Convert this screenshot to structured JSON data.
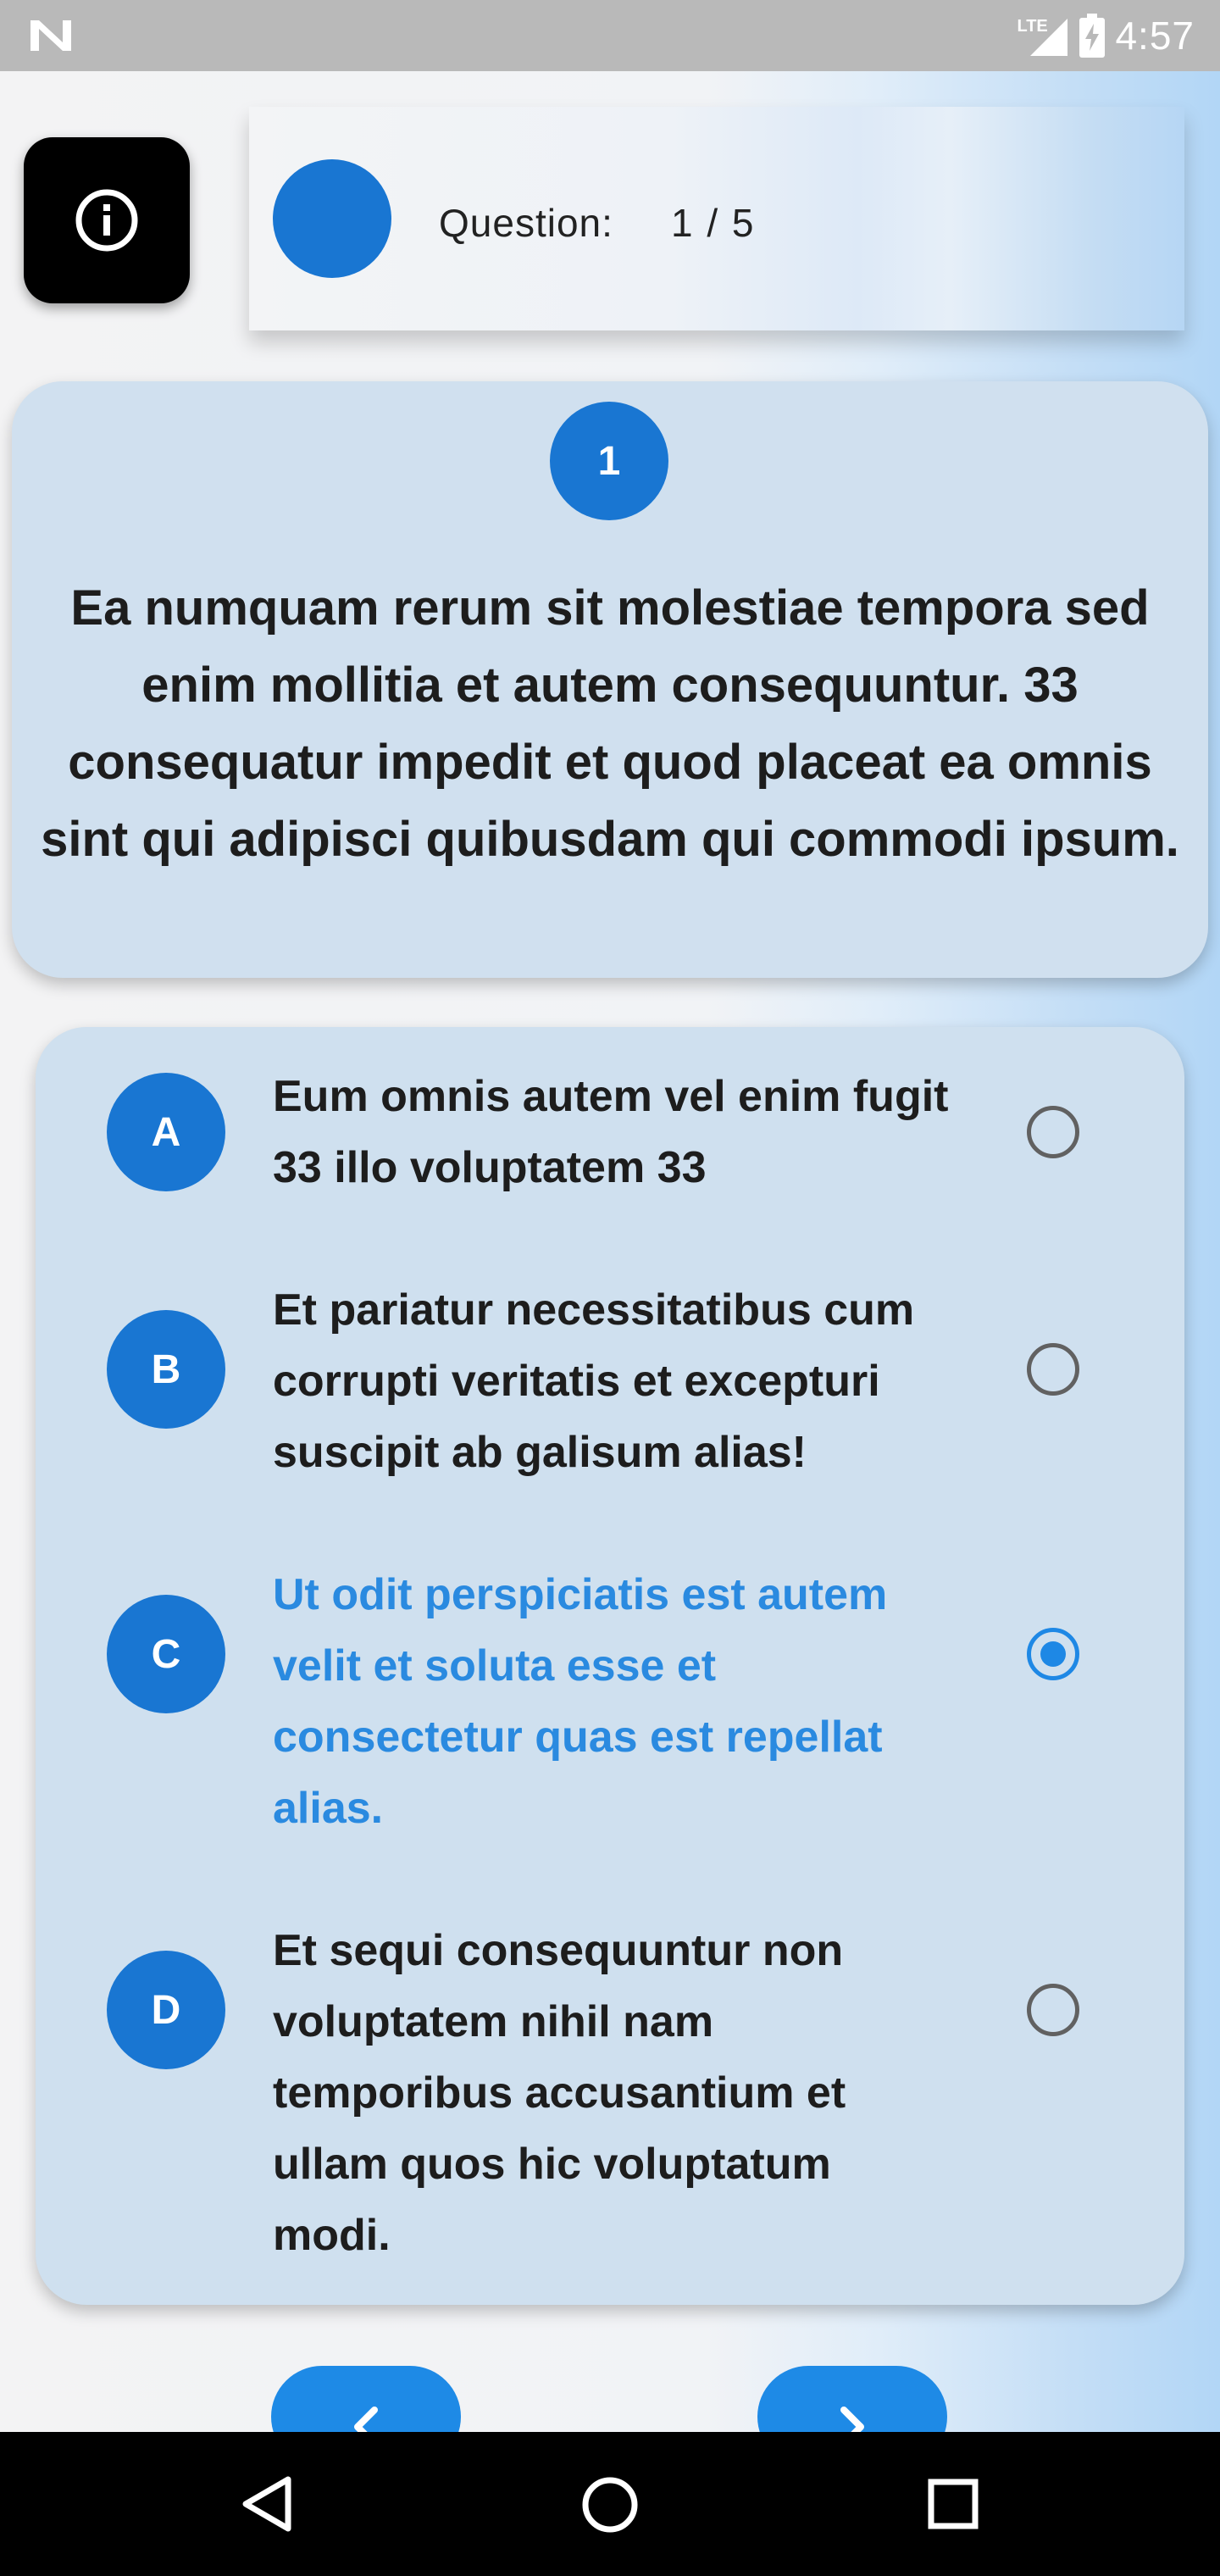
{
  "status_bar": {
    "time": "4:57",
    "network": "LTE",
    "icons": [
      "notification-n-icon",
      "signal-icon",
      "battery-charging-icon"
    ]
  },
  "header": {
    "info_icon": "info-icon",
    "question_label": "Question:",
    "question_counter": "1 / 5"
  },
  "question": {
    "number": "1",
    "text": "Ea numquam rerum sit molestiae tempora sed enim mollitia et autem consequuntur. 33 consequatur impedit et quod placeat ea omnis sint qui adipisci quibusdam qui commodi ipsum."
  },
  "options": [
    {
      "letter": "A",
      "text": "Eum omnis autem vel enim fugit 33 illo voluptatem 33",
      "selected": false
    },
    {
      "letter": "B",
      "text": "Et pariatur necessitatibus cum corrupti veritatis et excepturi suscipit ab galisum alias!",
      "selected": false
    },
    {
      "letter": "C",
      "text": "Ut odit perspiciatis est autem velit et soluta esse et consectetur quas est repellat alias.",
      "selected": true
    },
    {
      "letter": "D",
      "text": "Et sequi consequuntur non voluptatem nihil nam temporibus accusantium et ullam quos hic voluptatum modi.",
      "selected": false
    }
  ],
  "navigation": {
    "prev_icon": "chevron-left-icon",
    "next_icon": "chevron-right-icon"
  },
  "system_nav": {
    "icons": [
      "back-triangle-icon",
      "home-circle-icon",
      "recents-square-icon"
    ]
  },
  "colors": {
    "accent": "#1976d2",
    "selected_text": "#2a8ae0",
    "card": "#d0e0ef"
  }
}
